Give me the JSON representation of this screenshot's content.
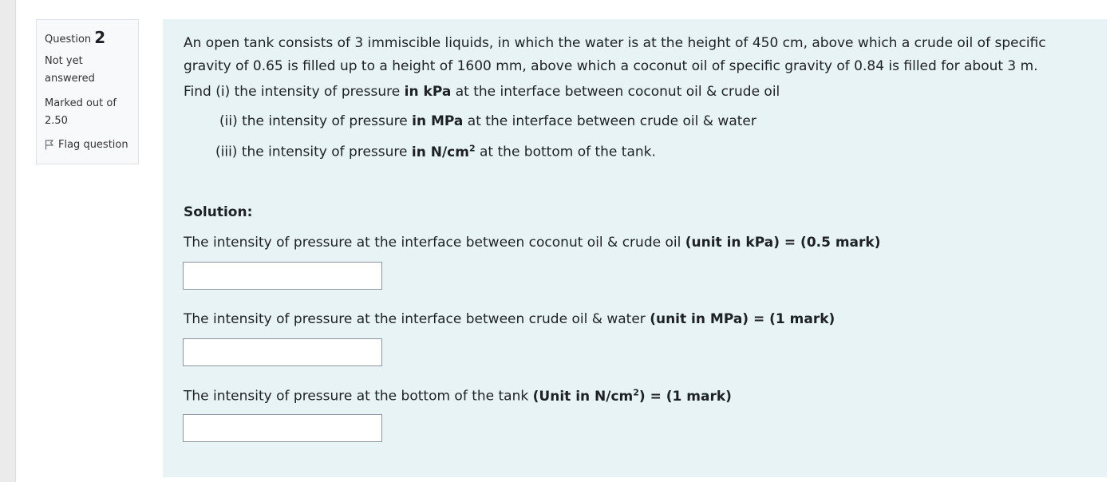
{
  "info": {
    "question_label": "Question",
    "question_number": "2",
    "state": "Not yet answered",
    "grade": "Marked out of 2.50",
    "flag_label": "Flag question"
  },
  "question": {
    "intro": "An open tank consists of 3 immiscible liquids, in which the water is at the height of 450 cm, above which a crude oil of specific gravity of 0.65 is filled up to a height of 1600 mm, above which a coconut oil of specific gravity of 0.84 is filled for about 3 m.",
    "find_prefix": "Find  (i) the intensity of pressure ",
    "find1_bold": "in kPa",
    "find1_rest": " at the interface between  coconut oil & crude oil",
    "find2_prefix": "(ii) the intensity of pressure ",
    "find2_bold": "in MPa",
    "find2_rest": " at the interface between  crude oil & water",
    "find3_prefix": "(iii) the intensity of pressure ",
    "find3_bold": "in N/cm",
    "find3_sup": "2",
    "find3_rest": " at the bottom of the tank."
  },
  "solution": {
    "title": "Solution:",
    "q1_text": "The intensity of pressure at the interface between coconut oil & crude oil  ",
    "q1_bold": "(unit in kPa) = (0.5 mark)",
    "q1_value": "",
    "q2_text": "The intensity of pressure at the interface between   crude oil & water ",
    "q2_bold": "(unit in MPa) = (1 mark)",
    "q2_value": "",
    "q3_text": "The intensity of pressure  at the bottom of the tank ",
    "q3_bold_a": "(Unit in N/cm",
    "q3_sup": "2",
    "q3_bold_b": ") = (1 mark)",
    "q3_value": ""
  }
}
